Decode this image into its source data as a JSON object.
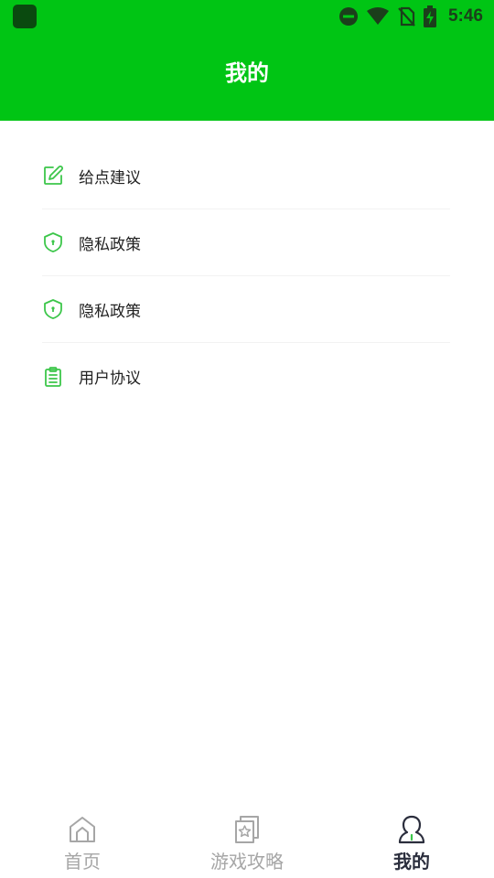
{
  "status_bar": {
    "time": "5:46"
  },
  "header": {
    "title": "我的"
  },
  "menu": {
    "items": [
      {
        "label": "给点建议",
        "icon": "edit-icon"
      },
      {
        "label": "隐私政策",
        "icon": "shield-icon"
      },
      {
        "label": "隐私政策",
        "icon": "shield-icon"
      },
      {
        "label": "用户协议",
        "icon": "clipboard-icon"
      }
    ]
  },
  "bottom_nav": {
    "items": [
      {
        "label": "首页",
        "icon": "home-icon",
        "active": false
      },
      {
        "label": "游戏攻略",
        "icon": "guide-icon",
        "active": false
      },
      {
        "label": "我的",
        "icon": "profile-icon",
        "active": true
      }
    ]
  },
  "colors": {
    "accent": "#00c514",
    "icon_green": "#3cc64a",
    "nav_inactive": "#a6a6a6",
    "nav_active": "#2b2e3d"
  }
}
